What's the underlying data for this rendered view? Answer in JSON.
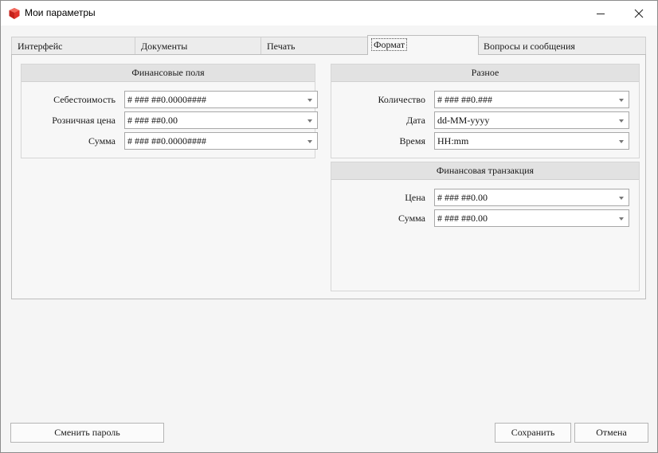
{
  "window": {
    "title": "Мои параметры",
    "icon": "app-logo-icon",
    "accent_color": "#e0322a"
  },
  "tabs": [
    {
      "label": "Интерфейс",
      "active": false
    },
    {
      "label": "Документы",
      "active": false
    },
    {
      "label": "Печать",
      "active": false
    },
    {
      "label": "Формат",
      "active": true
    },
    {
      "label": "Вопросы и сообщения",
      "active": false
    }
  ],
  "financial_fields": {
    "title": "Финансовые поля",
    "fields": [
      {
        "label": "Себестоимость",
        "value": "# ### ##0.0000####"
      },
      {
        "label": "Розничная цена",
        "value": "# ### ##0.00"
      },
      {
        "label": "Сумма",
        "value": "# ### ##0.0000####"
      }
    ]
  },
  "misc": {
    "title": "Разное",
    "fields": [
      {
        "label": "Количество",
        "value": "# ### ##0.###"
      },
      {
        "label": "Дата",
        "value": "dd-MM-yyyy"
      },
      {
        "label": "Время",
        "value": "HH:mm"
      }
    ]
  },
  "financial_transaction": {
    "title": "Финансовая транзакция",
    "fields": [
      {
        "label": "Цена",
        "value": "# ### ##0.00"
      },
      {
        "label": "Сумма",
        "value": "# ### ##0.00"
      }
    ]
  },
  "buttons": {
    "change_password": "Сменить пароль",
    "save": "Сохранить",
    "cancel": "Отмена"
  }
}
